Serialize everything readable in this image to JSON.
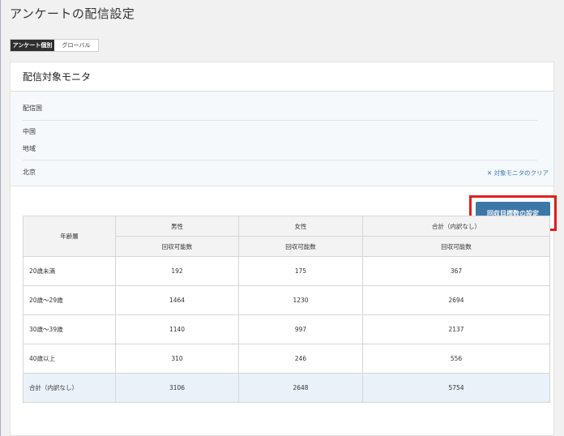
{
  "page": {
    "title": "アンケートの配信設定"
  },
  "tabs": [
    {
      "label": "アンケート個別"
    },
    {
      "label": "グローバル"
    }
  ],
  "section": {
    "title": "配信対象モニタ",
    "country_label": "配信国",
    "country_value": "中国",
    "region_label": "地域",
    "region_value": "北京",
    "clear_link": "✕ 対象モニタのクリア"
  },
  "action": {
    "set_target_label": "回収目標数の設定"
  },
  "table": {
    "age_header": "年齢層",
    "groups": [
      "男性",
      "女性",
      "合計（内訳なし）"
    ],
    "sub_header": "回収可能数",
    "rows": [
      {
        "age": "20歳未満",
        "male": "192",
        "female": "175",
        "total": "367"
      },
      {
        "age": "20歳～29歳",
        "male": "1464",
        "female": "1230",
        "total": "2694"
      },
      {
        "age": "30歳～39歳",
        "male": "1140",
        "female": "997",
        "total": "2137"
      },
      {
        "age": "40歳以上",
        "male": "310",
        "female": "246",
        "total": "556"
      },
      {
        "age": "合計（内訳なし）",
        "male": "3106",
        "female": "2648",
        "total": "5754"
      }
    ]
  }
}
